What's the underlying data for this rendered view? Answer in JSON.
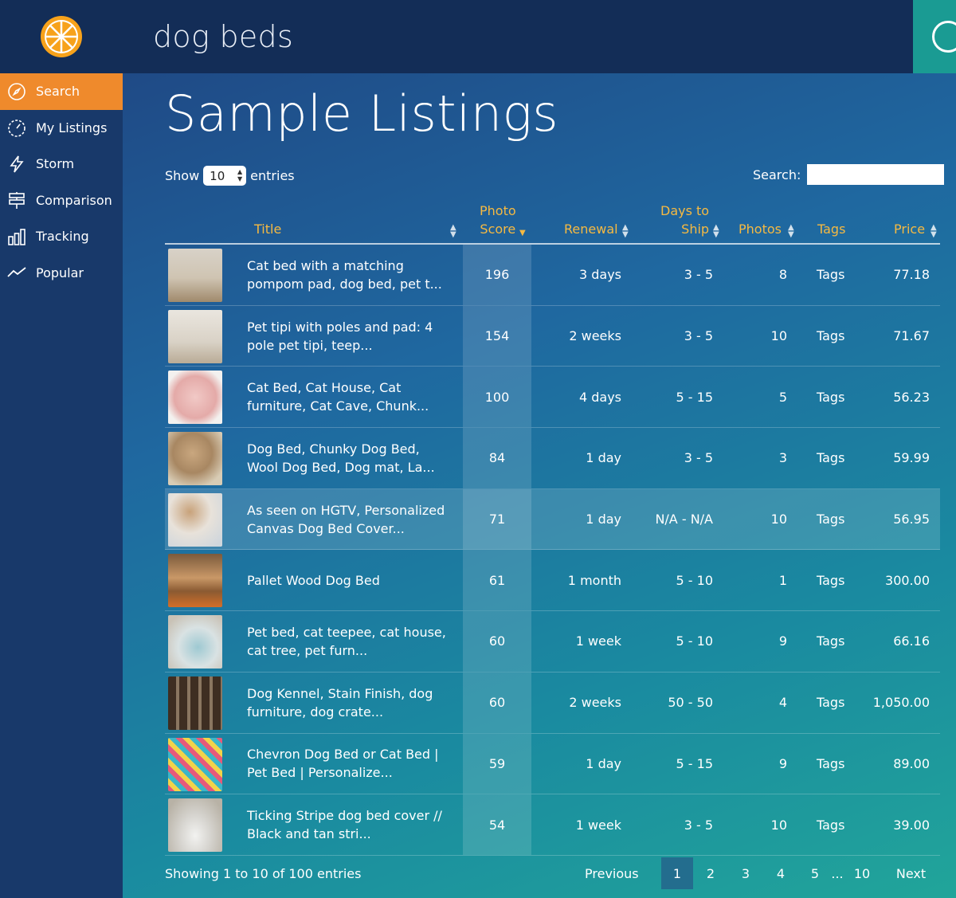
{
  "header": {
    "title": "dog beds"
  },
  "sidebar": {
    "items": [
      {
        "label": "Search",
        "icon": "compass-icon",
        "active": true
      },
      {
        "label": "My Listings",
        "icon": "gauge-icon",
        "active": false
      },
      {
        "label": "Storm",
        "icon": "lightning-icon",
        "active": false
      },
      {
        "label": "Comparison",
        "icon": "signpost-icon",
        "active": false
      },
      {
        "label": "Tracking",
        "icon": "bar-chart-icon",
        "active": false
      },
      {
        "label": "Popular",
        "icon": "trend-line-icon",
        "active": false
      }
    ]
  },
  "main": {
    "title": "Sample Listings",
    "show_label": "Show",
    "entries_value": "10",
    "entries_label": "entries",
    "search_label": "Search:",
    "search_value": ""
  },
  "table": {
    "headers": {
      "title": "Title",
      "photo_score_1": "Photo",
      "photo_score_2": "Score",
      "renewal": "Renewal",
      "days_1": "Days to",
      "days_2": "Ship",
      "photos": "Photos",
      "tags": "Tags",
      "price": "Price"
    },
    "rows": [
      {
        "title": "Cat bed with a matching pompom pad, dog bed, pet t...",
        "score": "196",
        "renewal": "3 days",
        "days": "3 - 5",
        "photos": "8",
        "tags": "Tags",
        "price": "77.18"
      },
      {
        "title": "Pet tipi with poles and pad: 4 pole pet tipi, teep...",
        "score": "154",
        "renewal": "2 weeks",
        "days": "3 - 5",
        "photos": "10",
        "tags": "Tags",
        "price": "71.67"
      },
      {
        "title": "Cat Bed, Cat House, Cat furniture, Cat Cave, Chunk...",
        "score": "100",
        "renewal": "4 days",
        "days": "5 - 15",
        "photos": "5",
        "tags": "Tags",
        "price": "56.23"
      },
      {
        "title": "Dog Bed, Chunky Dog Bed, Wool Dog Bed, Dog mat, La...",
        "score": "84",
        "renewal": "1 day",
        "days": "3 - 5",
        "photos": "3",
        "tags": "Tags",
        "price": "59.99"
      },
      {
        "title": "As seen on HGTV, Personalized Canvas Dog Bed Cover...",
        "score": "71",
        "renewal": "1 day",
        "days": "N/A - N/A",
        "photos": "10",
        "tags": "Tags",
        "price": "56.95"
      },
      {
        "title": "Pallet Wood Dog Bed",
        "score": "61",
        "renewal": "1 month",
        "days": "5 - 10",
        "photos": "1",
        "tags": "Tags",
        "price": "300.00"
      },
      {
        "title": "Pet bed, cat teepee, cat house, cat tree, pet furn...",
        "score": "60",
        "renewal": "1 week",
        "days": "5 - 10",
        "photos": "9",
        "tags": "Tags",
        "price": "66.16"
      },
      {
        "title": "Dog Kennel, Stain Finish, dog furniture, dog crate...",
        "score": "60",
        "renewal": "2 weeks",
        "days": "50 - 50",
        "photos": "4",
        "tags": "Tags",
        "price": "1,050.00"
      },
      {
        "title": "Chevron Dog Bed or Cat Bed | Pet Bed | Personalize...",
        "score": "59",
        "renewal": "1 day",
        "days": "5 - 15",
        "photos": "9",
        "tags": "Tags",
        "price": "89.00"
      },
      {
        "title": "Ticking Stripe dog bed cover // Black and tan stri...",
        "score": "54",
        "renewal": "1 week",
        "days": "3 - 5",
        "photos": "10",
        "tags": "Tags",
        "price": "39.00"
      }
    ]
  },
  "footer": {
    "info": "Showing 1 to 10 of 100 entries",
    "previous": "Previous",
    "pages": [
      "1",
      "2",
      "3",
      "4",
      "5",
      "...",
      "10"
    ],
    "current_page": "1",
    "next": "Next"
  },
  "colors": {
    "accent_orange": "#ef8a2c",
    "header_gold": "#f5b942",
    "header_bg": "#132d57",
    "teal_button": "#1a9b93"
  }
}
